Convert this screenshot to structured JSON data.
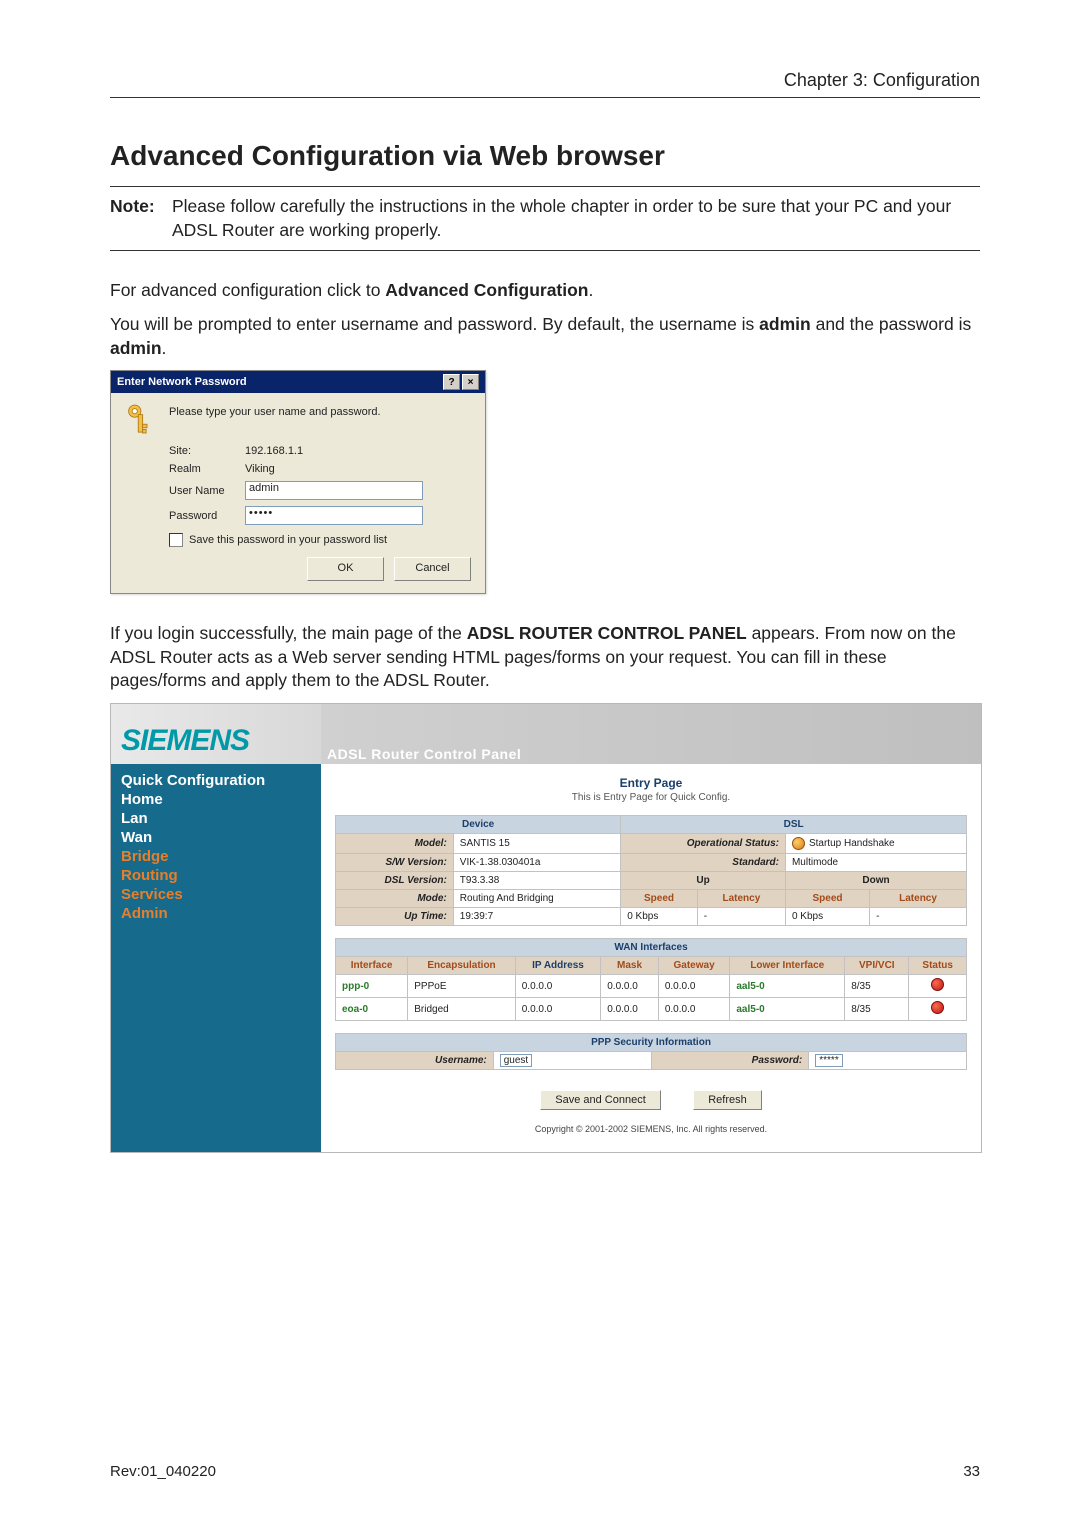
{
  "header": {
    "chapter": "Chapter 3: Configuration"
  },
  "heading": "Advanced Configuration via Web browser",
  "note": {
    "label": "Note:",
    "text": "Please follow carefully the instructions in the whole chapter in order to be sure that your PC and your ADSL Router are working properly."
  },
  "para1_a": "For advanced configuration click to ",
  "para1_b": "Advanced Configuration",
  "para1_c": ".",
  "para2_a": "You will be prompted to enter username and password. By default, the username is ",
  "para2_b": "admin",
  "para2_c": " and the password is ",
  "para2_d": "admin",
  "para2_e": ".",
  "dialog": {
    "title": "Enter Network Password",
    "help": "?",
    "close": "×",
    "prompt": "Please type your user name and password.",
    "site_label": "Site:",
    "site_value": "192.168.1.1",
    "realm_label": "Realm",
    "realm_value": "Viking",
    "username_label": "User Name",
    "username_value": "admin",
    "password_label": "Password",
    "password_value": "•••••",
    "save_label": "Save this password in your password list",
    "ok": "OK",
    "cancel": "Cancel"
  },
  "para3_a": "If you login successfully, the main page of the ",
  "para3_b": "ADSL ROUTER CONTROL PANEL",
  "para3_c": " appears. From now on the ADSL Router acts as a Web server sending HTML pages/forms on your request. You can fill in these pages/forms and apply them to the ADSL Router.",
  "panel": {
    "logo": "SIEMENS",
    "bar": "ADSL Router Control Panel",
    "sidebar": [
      "Quick Configuration",
      "Home",
      "Lan",
      "Wan",
      "Bridge",
      "Routing",
      "Services",
      "Admin"
    ],
    "title": "Entry Page",
    "subtitle": "This is Entry Page for Quick Config.",
    "device_head": "Device",
    "dsl_head": "DSL",
    "device_rows": [
      {
        "label": "Model:",
        "value": "SANTIS 15"
      },
      {
        "label": "S/W Version:",
        "value": "VIK-1.38.030401a"
      },
      {
        "label": "DSL Version:",
        "value": "T93.3.38"
      },
      {
        "label": "Mode:",
        "value": "Routing And Bridging"
      },
      {
        "label": "Up Time:",
        "value": "19:39:7"
      }
    ],
    "dsl_op_label": "Operational Status:",
    "dsl_op_value": "Startup Handshake",
    "dsl_std_label": "Standard:",
    "dsl_std_value": "Multimode",
    "up": "Up",
    "down": "Down",
    "speed": "Speed",
    "latency": "Latency",
    "up_speed": "0 Kbps",
    "up_lat": "-",
    "down_speed": "0 Kbps",
    "down_lat": "-",
    "wan_head": "WAN Interfaces",
    "wan_cols": [
      "Interface",
      "Encapsulation",
      "IP Address",
      "Mask",
      "Gateway",
      "Lower Interface",
      "VPI/VCI",
      "Status"
    ],
    "wan_rows": [
      {
        "iface": "ppp-0",
        "encap": "PPPoE",
        "ip": "0.0.0.0",
        "mask": "0.0.0.0",
        "gw": "0.0.0.0",
        "lower": "aal5-0",
        "vpi": "8/35"
      },
      {
        "iface": "eoa-0",
        "encap": "Bridged",
        "ip": "0.0.0.0",
        "mask": "0.0.0.0",
        "gw": "0.0.0.0",
        "lower": "aal5-0",
        "vpi": "8/35"
      }
    ],
    "ppp_head": "PPP Security Information",
    "ppp_user_label": "Username:",
    "ppp_user_value": "guest",
    "ppp_pass_label": "Password:",
    "ppp_pass_value": "*****",
    "save_btn": "Save and Connect",
    "refresh_btn": "Refresh",
    "copyright": "Copyright © 2001-2002 SIEMENS, Inc. All rights reserved."
  },
  "footer": {
    "rev": "Rev:01_040220",
    "page": "33"
  }
}
